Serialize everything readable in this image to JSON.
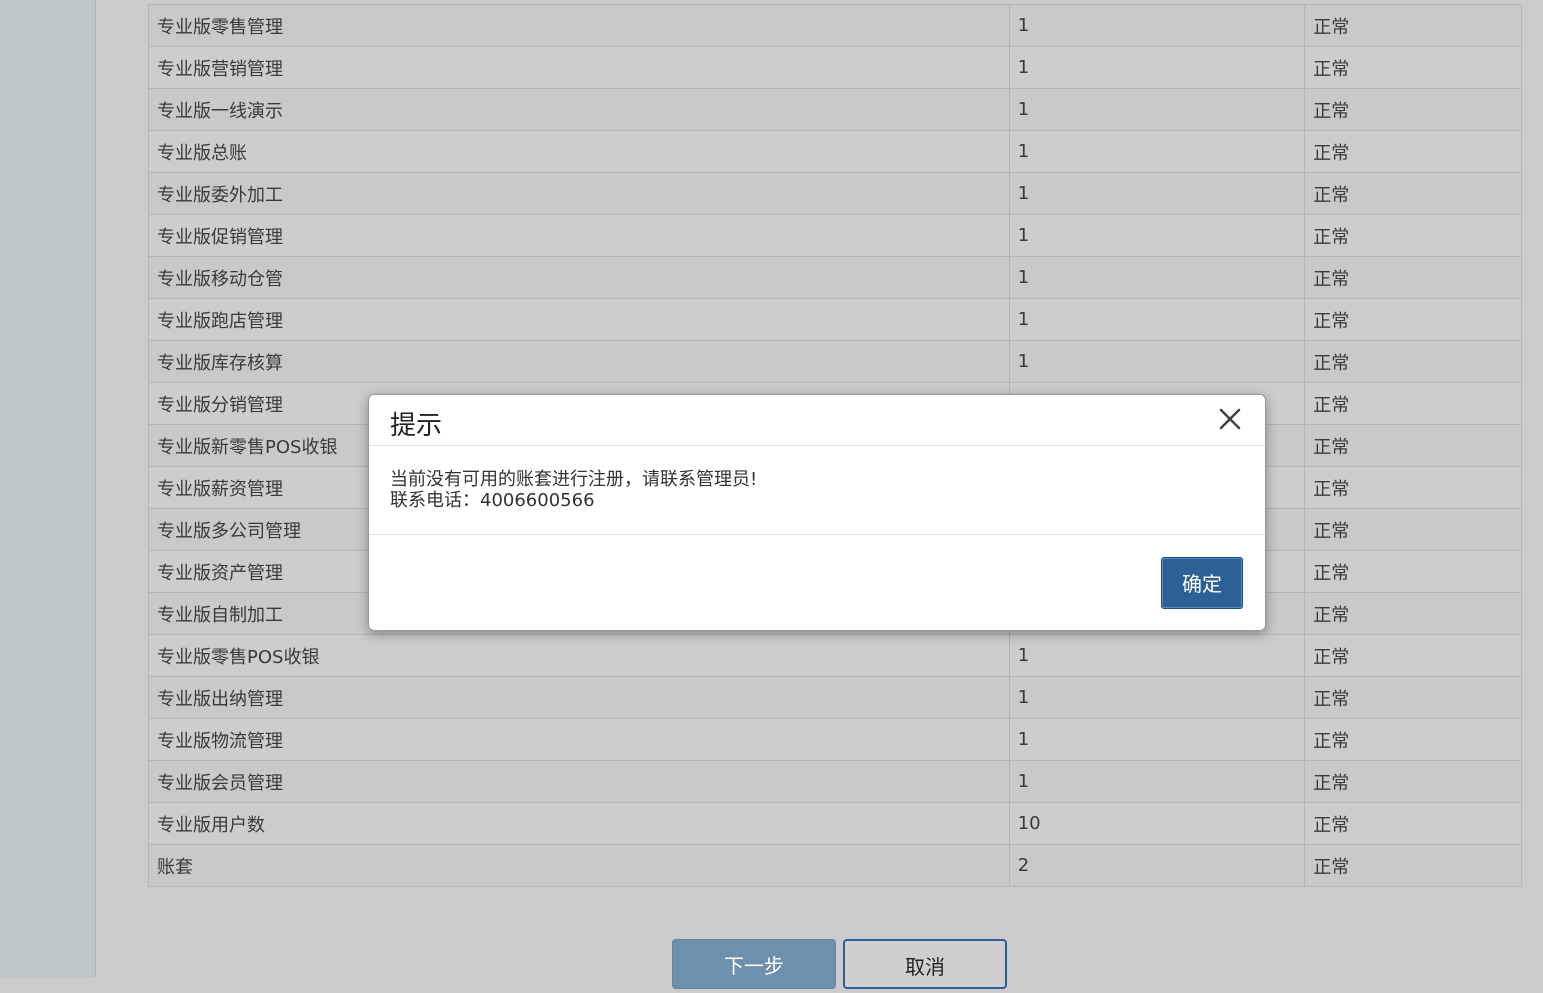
{
  "table": {
    "rows": [
      {
        "name": "专业版零售管理",
        "qty": "1",
        "status": "正常"
      },
      {
        "name": "专业版营销管理",
        "qty": "1",
        "status": "正常"
      },
      {
        "name": "专业版一线演示",
        "qty": "1",
        "status": "正常"
      },
      {
        "name": "专业版总账",
        "qty": "1",
        "status": "正常"
      },
      {
        "name": "专业版委外加工",
        "qty": "1",
        "status": "正常"
      },
      {
        "name": "专业版促销管理",
        "qty": "1",
        "status": "正常"
      },
      {
        "name": "专业版移动仓管",
        "qty": "1",
        "status": "正常"
      },
      {
        "name": "专业版跑店管理",
        "qty": "1",
        "status": "正常"
      },
      {
        "name": "专业版库存核算",
        "qty": "1",
        "status": "正常"
      },
      {
        "name": "专业版分销管理",
        "qty": "",
        "status": "正常"
      },
      {
        "name": "专业版新零售POS收银",
        "qty": "",
        "status": "正常"
      },
      {
        "name": "专业版薪资管理",
        "qty": "",
        "status": "正常"
      },
      {
        "name": "专业版多公司管理",
        "qty": "",
        "status": "正常"
      },
      {
        "name": "专业版资产管理",
        "qty": "",
        "status": "正常"
      },
      {
        "name": "专业版自制加工",
        "qty": "",
        "status": "正常"
      },
      {
        "name": "专业版零售POS收银",
        "qty": "1",
        "status": "正常"
      },
      {
        "name": "专业版出纳管理",
        "qty": "1",
        "status": "正常"
      },
      {
        "name": "专业版物流管理",
        "qty": "1",
        "status": "正常"
      },
      {
        "name": "专业版会员管理",
        "qty": "1",
        "status": "正常"
      },
      {
        "name": "专业版用户数",
        "qty": "10",
        "status": "正常"
      },
      {
        "name": "账套",
        "qty": "2",
        "status": "正常"
      }
    ]
  },
  "buttons": {
    "next": "下一步",
    "cancel": "取消"
  },
  "dialog": {
    "title": "提示",
    "message_line1": "当前没有可用的账套进行注册，请联系管理员!",
    "message_line2": "联系电话：4006600566",
    "confirm": "确定"
  }
}
